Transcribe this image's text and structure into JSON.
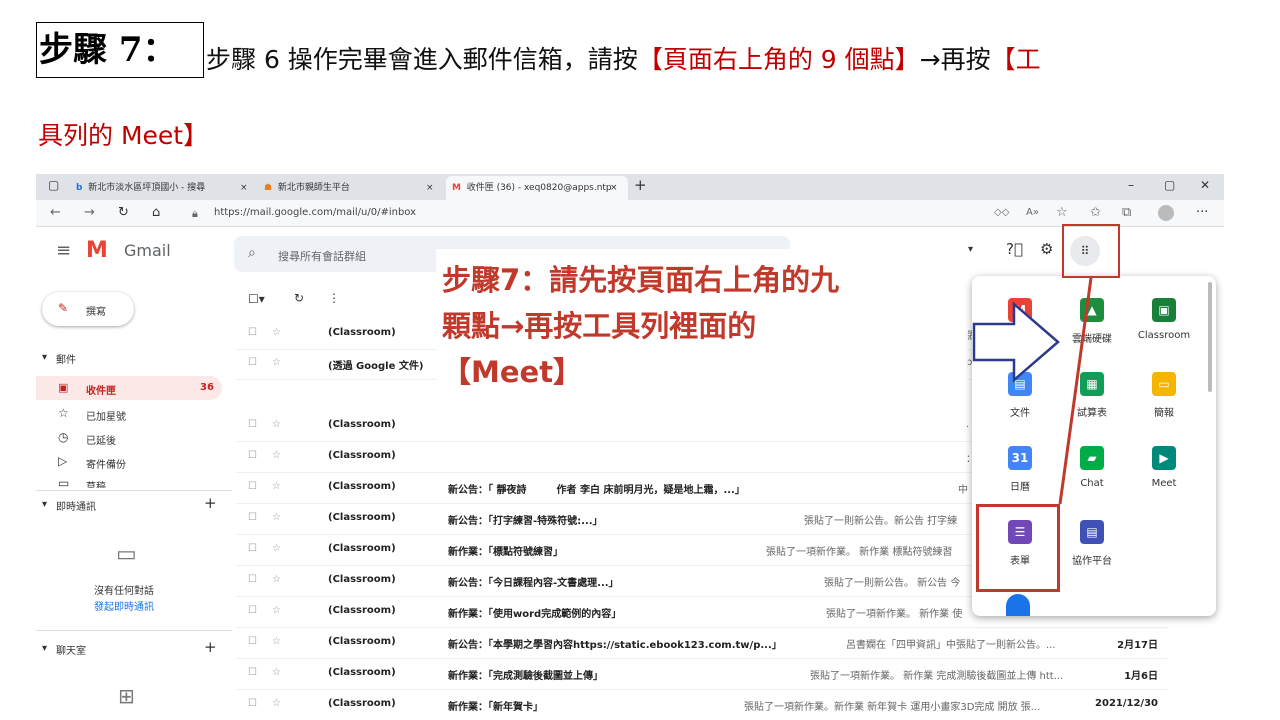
{
  "instruction": {
    "step_label": "步驟 7：",
    "line1_black": "步驟 6 操作完畢會進入郵件信箱，請按",
    "line1_red": "【頁面右上角的 9 個點】",
    "line1_arrow": "→再按",
    "line1_red2": "【工",
    "line2_red": "具列的 Meet】"
  },
  "browser": {
    "tabs": [
      {
        "label": "新北市淡水區坪頂國小 - 搜尋"
      },
      {
        "label": "新北市親師生平台"
      },
      {
        "label": "收件匣 (36) - xeq0820@apps.ntp"
      }
    ],
    "url": "https://mail.google.com/mail/u/0/#inbox"
  },
  "gmail": {
    "logo_text": "Gmail",
    "search_placeholder": "搜尋所有會話群組",
    "compose": "撰寫",
    "mail_section": "郵件",
    "nav": [
      {
        "label": "收件匣",
        "count": "36"
      },
      {
        "label": "已加星號"
      },
      {
        "label": "已延後"
      },
      {
        "label": "寄件備份"
      },
      {
        "label": "草稿"
      }
    ],
    "chat_section": "即時通訊",
    "no_chat": "沒有任何對話",
    "start_chat": "發起即時通訊",
    "rooms_section": "聊天室",
    "rows": [
      {
        "sender": "(Classroom)",
        "subject": "",
        "snippet": "張",
        "date": ""
      },
      {
        "sender": "(透過 Google 文件)",
        "subject": "",
        "snippet": "po",
        "date": ""
      },
      {
        "sender": "(Classroom)",
        "subject": "",
        "snippet": ".",
        "date": ""
      },
      {
        "sender": "(Classroom)",
        "subject": "",
        "snippet": "：",
        "date": ""
      },
      {
        "sender": "(Classroom)",
        "subject": "新公告：「 靜夜詩　　　作者 李白 床前明月光，疑是地上霜，...」",
        "snippet": "中",
        "date": ""
      },
      {
        "sender": "(Classroom)",
        "subject": "新公告：「打字練習-特殊符號:...」",
        "snippet": "張貼了一則新公告。新公告 打字練",
        "date": ""
      },
      {
        "sender": "(Classroom)",
        "subject": "新作業：「標點符號練習」",
        "snippet": "張貼了一項新作業。 新作業 標點符號練習",
        "date": ""
      },
      {
        "sender": "(Classroom)",
        "subject": "新公告：「今日課程內容-文書處理...」",
        "snippet": "張貼了一則新公告。 新公告 今",
        "date": ""
      },
      {
        "sender": "(Classroom)",
        "subject": "新作業：「使用word完成範例的內容」",
        "snippet": "張貼了一項新作業。 新作業 使",
        "date": ""
      },
      {
        "sender": "(Classroom)",
        "subject": "新公告：「本學期之學習內容https://static.ebook123.com.tw/p...」",
        "snippet": "呂書嫻在「四甲資訊」中張貼了一則新公告。...",
        "date": "2月17日"
      },
      {
        "sender": "(Classroom)",
        "subject": "新作業：「完成測驗後截圖並上傳」",
        "snippet": "張貼了一項新作業。 新作業 完成測驗後截圖並上傳 htt...",
        "date": "1月6日"
      },
      {
        "sender": "(Classroom)",
        "subject": "新作業：「新年賀卡」",
        "snippet": "張貼了一項新作業。新作業 新年賀卡 運用小畫家3D完成 開放 張...",
        "date": "2021/12/30"
      }
    ]
  },
  "overlay": {
    "line1": "步驟7：請先按頁面右上角的九",
    "line2": "顆點→再按工具列裡面的",
    "line3": "【Meet】"
  },
  "apps": [
    {
      "label": "Gmail",
      "color": "#ea4335"
    },
    {
      "label": "雲端硬碟",
      "color": "#1e8e3e"
    },
    {
      "label": "Classroom",
      "color": "#188038"
    },
    {
      "label": "文件",
      "color": "#4285f4"
    },
    {
      "label": "試算表",
      "color": "#0f9d58"
    },
    {
      "label": "簡報",
      "color": "#f4b400"
    },
    {
      "label": "日曆",
      "color": "#4285f4"
    },
    {
      "label": "Chat",
      "color": "#00ac47"
    },
    {
      "label": "Meet",
      "color": "#00897b"
    },
    {
      "label": "表單",
      "color": "#7248b9"
    },
    {
      "label": "協作平台",
      "color": "#3f51b5"
    }
  ]
}
